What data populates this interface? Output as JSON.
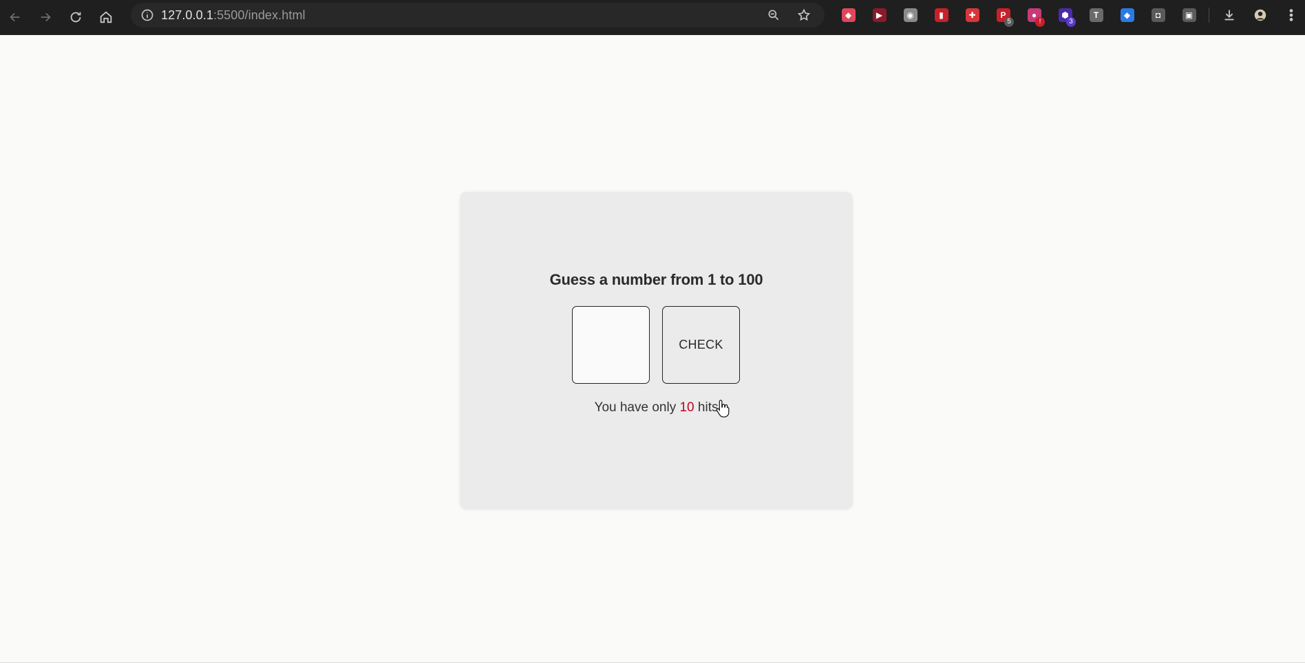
{
  "browser": {
    "url_host": "127.0.0.1",
    "url_path": ":5500/index.html",
    "icons": {
      "back": "arrow-left-icon",
      "forward": "arrow-right-icon",
      "reload": "reload-icon",
      "home": "home-icon",
      "site_info": "info-icon",
      "zoom": "zoom-icon",
      "bookmark": "star-icon"
    },
    "extensions": [
      {
        "name": "shield-extension",
        "color": "#e0475a",
        "glyph": "◆",
        "badge": ""
      },
      {
        "name": "play-extension",
        "color": "#8a1a2a",
        "glyph": "▶",
        "badge": ""
      },
      {
        "name": "globe-extension",
        "color": "#8a8a8a",
        "glyph": "◉",
        "badge": ""
      },
      {
        "name": "book-extension",
        "color": "#c8202a",
        "glyph": "▮",
        "badge": ""
      },
      {
        "name": "cross-extension",
        "color": "#d8363a",
        "glyph": "✚",
        "badge": ""
      },
      {
        "name": "p-extension",
        "color": "#c8202a",
        "glyph": "P",
        "badge": "5",
        "badge_color": "#5a5a5a"
      },
      {
        "name": "circle-extension",
        "color": "#c83a7a",
        "glyph": "●",
        "badge": "!",
        "badge_color": "#c8202a"
      },
      {
        "name": "hex-extension",
        "color": "#4a2aa8",
        "glyph": "⬢",
        "badge": "3",
        "badge_color": "#5a3ac8"
      },
      {
        "name": "t-extension",
        "color": "#6a6a6a",
        "glyph": "T",
        "badge": ""
      },
      {
        "name": "diamond-extension",
        "color": "#2a7ae8",
        "glyph": "◆",
        "badge": ""
      },
      {
        "name": "camera-extension",
        "color": "#5a5a5a",
        "glyph": "◘",
        "badge": ""
      },
      {
        "name": "puzzle-extension",
        "color": "#5a5a5a",
        "glyph": "▣",
        "badge": ""
      }
    ]
  },
  "game": {
    "title": "Guess a number from 1 to 100",
    "input_value": "",
    "check_label": "CHECK",
    "hits_prefix": "You have only ",
    "hits_count": "10",
    "hits_suffix": " hits"
  },
  "colors": {
    "accent_hits": "#c0001a",
    "card_bg": "#ebebeb"
  }
}
